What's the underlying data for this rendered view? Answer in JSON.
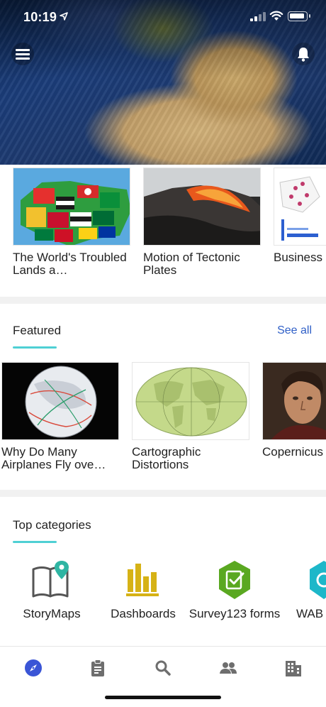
{
  "status_bar": {
    "time": "10:19"
  },
  "recent": {
    "cards": [
      {
        "title": "The World's Troubled Lands a…"
      },
      {
        "title": "Motion of Tectonic Plates"
      },
      {
        "title": "Business"
      }
    ]
  },
  "featured": {
    "title": "Featured",
    "see_all": "See all",
    "cards": [
      {
        "title": "Why Do Many Airplanes Fly ove…"
      },
      {
        "title": "Cartographic Distortions"
      },
      {
        "title": "Copernicus Universe"
      }
    ]
  },
  "top_categories": {
    "title": "Top categories",
    "items": [
      {
        "label": "StoryMaps",
        "icon": "storymaps-icon"
      },
      {
        "label": "Dashboards",
        "icon": "dashboards-icon"
      },
      {
        "label": "Survey123 forms",
        "icon": "survey123-icon"
      },
      {
        "label": "WAB",
        "icon": "wab-icon"
      }
    ]
  },
  "tabbar": {
    "items": [
      {
        "icon": "compass-icon",
        "active": true
      },
      {
        "icon": "clipboard-icon",
        "active": false
      },
      {
        "icon": "search-icon",
        "active": false
      },
      {
        "icon": "people-icon",
        "active": false
      },
      {
        "icon": "building-icon",
        "active": false
      }
    ],
    "active_color": "#3a55d6",
    "inactive_color": "#6e6e6e"
  },
  "colors": {
    "accent_underline": "#4fd0d4",
    "link": "#2f5fc7"
  }
}
